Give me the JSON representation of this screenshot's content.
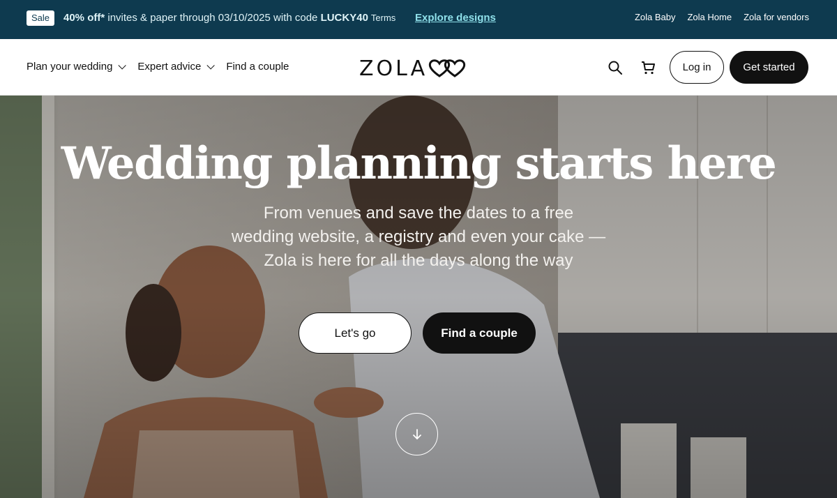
{
  "promo": {
    "badge": "Sale",
    "offer_bold": "40% off*",
    "offer_text": " invites & paper through 03/10/2025 with code ",
    "code": "LUCKY40",
    "terms": "Terms",
    "explore": "Explore designs",
    "links": [
      "Zola Baby",
      "Zola Home",
      "Zola for vendors"
    ]
  },
  "header": {
    "nav": [
      {
        "label": "Plan your wedding",
        "icon": "chevron-down-icon"
      },
      {
        "label": "Expert advice",
        "icon": "chevron-down-icon"
      },
      {
        "label": "Find a couple"
      }
    ],
    "logo": "ZOLA",
    "login": "Log in",
    "get_started": "Get started"
  },
  "hero": {
    "title": "Wedding planning starts here",
    "subtitle": "From venues and save the dates to a free wedding website, a registry and even your cake — Zola is here for all the days along the way",
    "cta_primary": "Let's go",
    "cta_secondary": "Find a couple"
  },
  "colors": {
    "promo_bg": "#0e3a4f",
    "promo_link": "#8fe0ea",
    "button_dark": "#111111"
  }
}
